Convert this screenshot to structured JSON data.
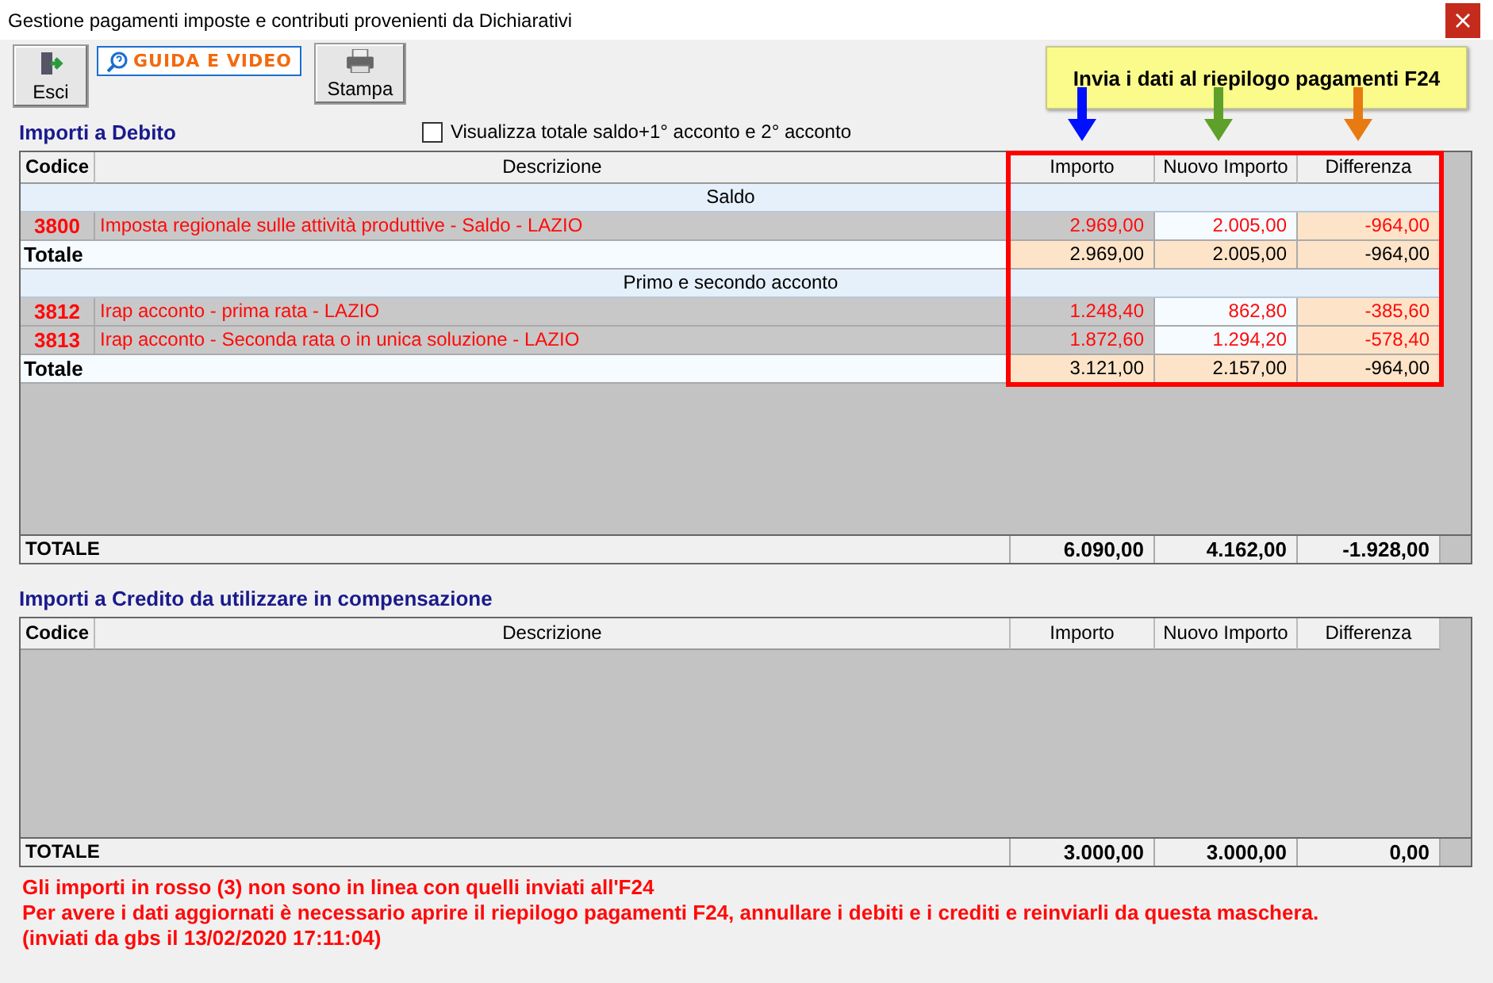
{
  "window": {
    "title": "Gestione pagamenti imposte e contributi provenienti da Dichiarativi"
  },
  "toolbar": [
    {
      "kind": "exit",
      "label": "Esci"
    },
    {
      "kind": "guide",
      "label": "GUIDA E VIDEO"
    },
    {
      "kind": "print",
      "label": "Stampa"
    }
  ],
  "send_button": {
    "label": "Invia i dati al riepilogo pagamenti F24"
  },
  "debit": {
    "title": "Importi a Debito",
    "checkbox": {
      "label": "Visualizza totale saldo+1° acconto e 2° acconto",
      "checked": false
    },
    "columns": [
      "Codice",
      "Descrizione",
      "Importo",
      "Nuovo Importo",
      "Differenza"
    ],
    "rows": [
      {
        "kind": "group",
        "label": "Saldo"
      },
      {
        "kind": "item",
        "code": "3800",
        "description": "Imposta regionale sulle attività produttive - Saldo - LAZIO",
        "importo": "2.969,00",
        "nuovo_importo": "2.005,00",
        "differenza": "-964,00",
        "mismatch": true
      },
      {
        "kind": "total",
        "label": "Totale",
        "importo": "2.969,00",
        "nuovo_importo": "2.005,00",
        "differenza": "-964,00"
      },
      {
        "kind": "group",
        "label": "Primo e secondo acconto"
      },
      {
        "kind": "item",
        "code": "3812",
        "description": "Irap acconto - prima rata - LAZIO",
        "importo": "1.248,40",
        "nuovo_importo": "862,80",
        "differenza": "-385,60",
        "mismatch": true
      },
      {
        "kind": "item",
        "code": "3813",
        "description": "Irap acconto - Seconda rata o in unica soluzione - LAZIO",
        "importo": "1.872,60",
        "nuovo_importo": "1.294,20",
        "differenza": "-578,40",
        "mismatch": true
      },
      {
        "kind": "total",
        "label": "Totale",
        "importo": "3.121,00",
        "nuovo_importo": "2.157,00",
        "differenza": "-964,00"
      }
    ],
    "grand_total": {
      "label": "TOTALE",
      "importo": "6.090,00",
      "nuovo_importo": "4.162,00",
      "differenza": "-1.928,00"
    }
  },
  "credit": {
    "title": "Importi a Credito da utilizzare in compensazione",
    "columns": [
      "Codice",
      "Descrizione",
      "Importo",
      "Nuovo Importo",
      "Differenza"
    ],
    "grand_total": {
      "label": "TOTALE",
      "importo": "3.000,00",
      "nuovo_importo": "3.000,00",
      "differenza": "0,00"
    }
  },
  "messages": [
    "Gli importi in rosso (3) non sono in linea con quelli inviati all'F24",
    "Per avere i dati aggiornati è necessario aprire il riepilogo pagamenti F24, annullare i debiti e i crediti e reinviarli da questa maschera.",
    "(inviati da gbs il 13/02/2020 17:11:04)"
  ]
}
